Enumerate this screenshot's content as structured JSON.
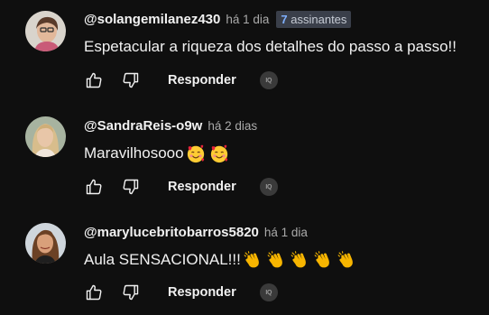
{
  "comments": [
    {
      "author": "@solangemilanez430",
      "time": "há 1 dia",
      "badge": {
        "count": "7",
        "label": "assinantes"
      },
      "text": "Espetacular a riqueza dos detalhes do passo a passo!!",
      "emojis": [],
      "reply_label": "Responder",
      "extension_label": "IQ"
    },
    {
      "author": "@SandraReis-o9w",
      "time": "há 2 dias",
      "text": "Maravilhosooo",
      "emojis": [
        "smiling-face-with-hearts-emoji",
        "smiling-face-with-hearts-emoji"
      ],
      "reply_label": "Responder",
      "extension_label": "IQ"
    },
    {
      "author": "@marylucebritobarros5820",
      "time": "há 1 dia",
      "text": "Aula SENSACIONAL!!!",
      "emojis": [
        "clapping-hands-emoji",
        "clapping-hands-emoji",
        "clapping-hands-emoji",
        "clapping-hands-emoji",
        "clapping-hands-emoji"
      ],
      "reply_label": "Responder",
      "extension_label": "IQ"
    }
  ],
  "colors": {
    "background": "#0f0f0f",
    "text": "#f1f1f1",
    "secondary_text": "#aaaaaa",
    "badge_bg": "#3a3f4a",
    "badge_num": "#7fb0ff"
  },
  "icons": {
    "like": "thumbs-up-icon",
    "dislike": "thumbs-down-icon",
    "extension": "iq-extension-icon"
  }
}
